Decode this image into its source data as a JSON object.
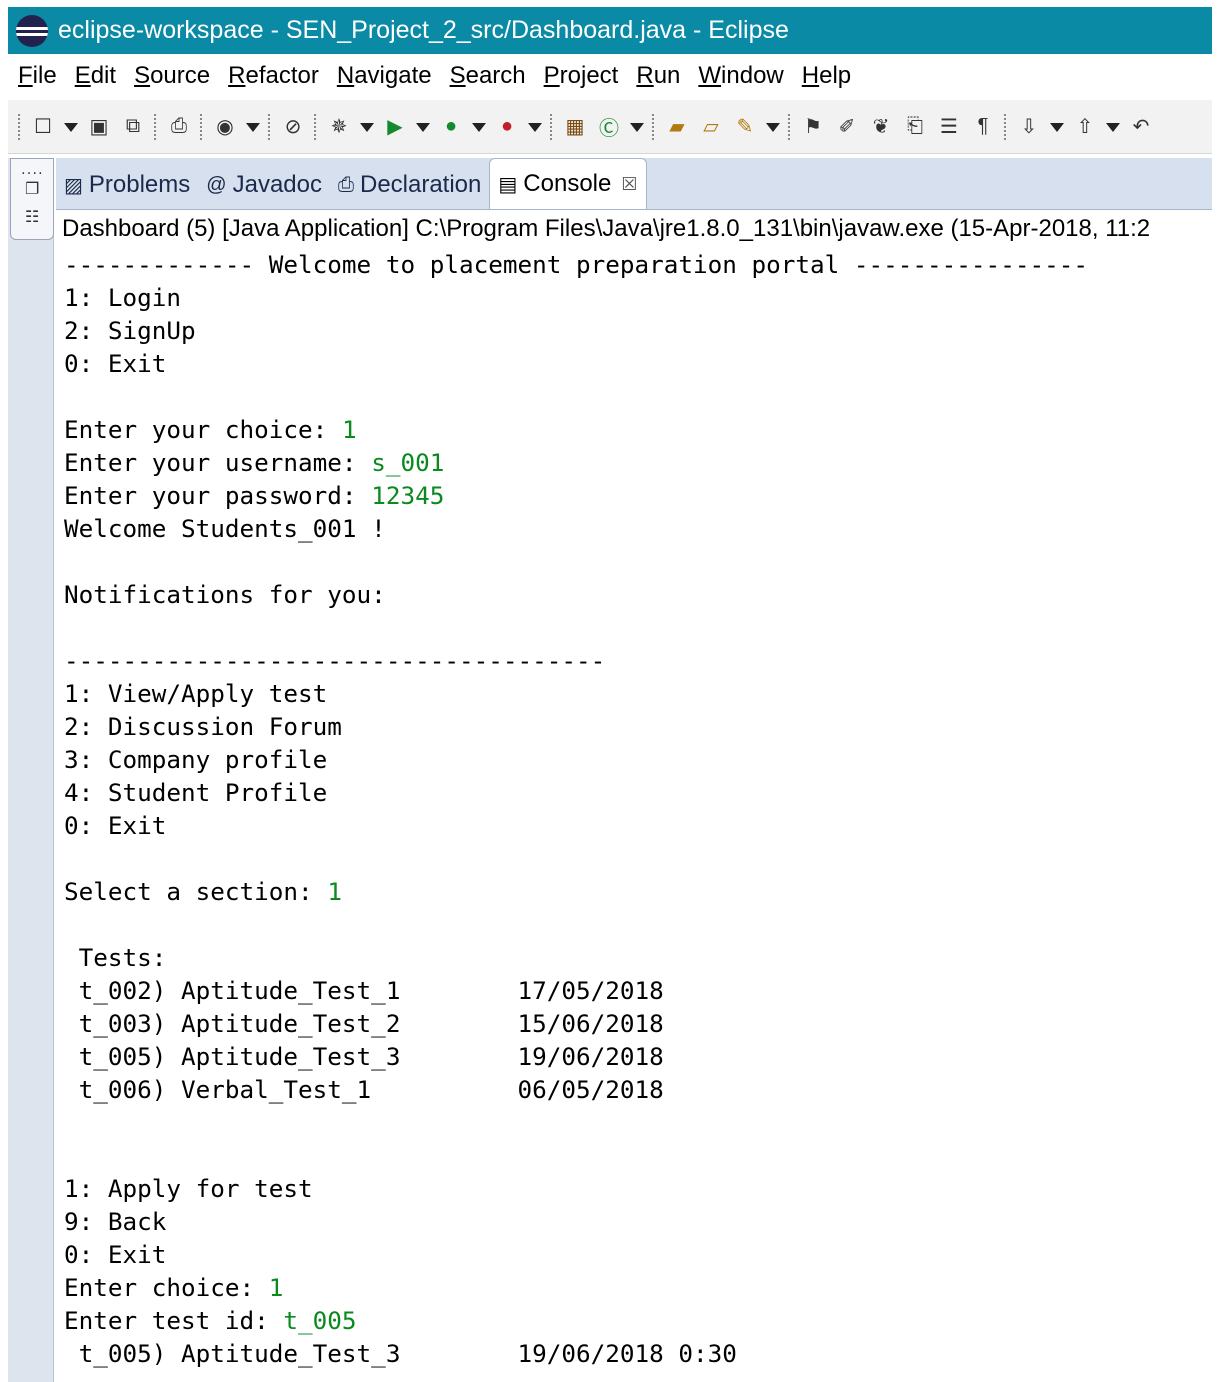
{
  "window": {
    "title": "eclipse-workspace - SEN_Project_2_src/Dashboard.java - Eclipse",
    "logo_icon": "eclipse-logo-icon"
  },
  "menu": [
    "File",
    "Edit",
    "Source",
    "Refactor",
    "Navigate",
    "Search",
    "Project",
    "Run",
    "Window",
    "Help"
  ],
  "tabs": [
    {
      "label": "Problems",
      "icon": "problems-icon"
    },
    {
      "label": "Javadoc",
      "icon": "javadoc-icon"
    },
    {
      "label": "Declaration",
      "icon": "declaration-icon"
    },
    {
      "label": "Console",
      "icon": "console-icon",
      "active": true
    }
  ],
  "console": {
    "header": "Dashboard (5) [Java Application] C:\\Program Files\\Java\\jre1.8.0_131\\bin\\javaw.exe (15-Apr-2018, 11:2",
    "input_color": "#0a8a1e",
    "lines": [
      {
        "text": "------------- Welcome to placement preparation portal ----------------"
      },
      {
        "text": "1: Login"
      },
      {
        "text": "2: SignUp"
      },
      {
        "text": "0: Exit"
      },
      {
        "text": ""
      },
      {
        "text": "Enter your choice: ",
        "input": "1"
      },
      {
        "text": "Enter your username: ",
        "input": "s_001"
      },
      {
        "text": "Enter your password: ",
        "input": "12345"
      },
      {
        "text": "Welcome Students_001 !"
      },
      {
        "text": ""
      },
      {
        "text": "Notifications for you:"
      },
      {
        "text": ""
      },
      {
        "text": "-------------------------------------"
      },
      {
        "text": "1: View/Apply test"
      },
      {
        "text": "2: Discussion Forum"
      },
      {
        "text": "3: Company profile"
      },
      {
        "text": "4: Student Profile"
      },
      {
        "text": "0: Exit"
      },
      {
        "text": ""
      },
      {
        "text": "Select a section: ",
        "input": "1"
      },
      {
        "text": ""
      },
      {
        "text": " Tests:"
      },
      {
        "text": " t_002) Aptitude_Test_1        17/05/2018"
      },
      {
        "text": " t_003) Aptitude_Test_2        15/06/2018"
      },
      {
        "text": " t_005) Aptitude_Test_3        19/06/2018"
      },
      {
        "text": " t_006) Verbal_Test_1          06/05/2018"
      },
      {
        "text": ""
      },
      {
        "text": ""
      },
      {
        "text": "1: Apply for test"
      },
      {
        "text": "9: Back"
      },
      {
        "text": "0: Exit"
      },
      {
        "text": "Enter choice: ",
        "input": "1"
      },
      {
        "text": "Enter test id: ",
        "input": "t_005"
      },
      {
        "text": " t_005) Aptitude_Test_3        19/06/2018 0:30"
      }
    ]
  }
}
